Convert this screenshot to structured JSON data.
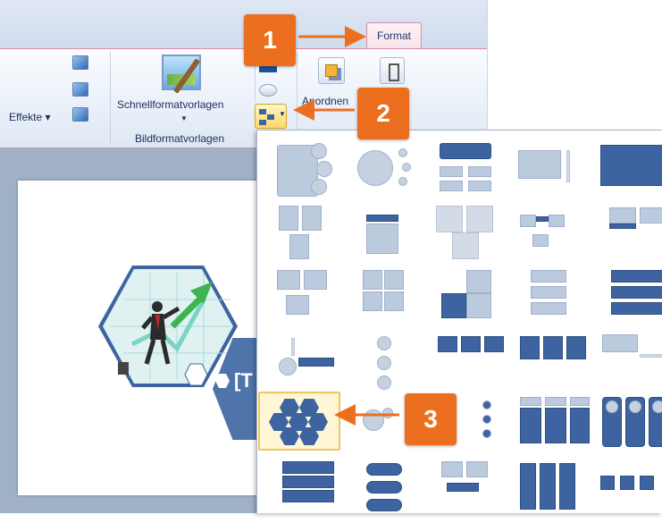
{
  "ribbon": {
    "tab_format": "Format",
    "effekte": "Effekte",
    "schnellformatvorlagen": "Schnellformatvorlagen",
    "bildformatvorlagen": "Bildformatvorlagen",
    "anordnen": "Anordnen"
  },
  "slide": {
    "placeholder_text": "[T"
  },
  "callouts": {
    "one": "1",
    "two": "2",
    "three": "3"
  },
  "colors": {
    "accent_orange": "#ec6f1f",
    "smartart_blue": "#3d64a0",
    "selection": "#f0c75e"
  },
  "icons": [
    "effects-icon",
    "picture-icon",
    "smartart-layout-icon",
    "arrange-icon",
    "align-icon"
  ]
}
